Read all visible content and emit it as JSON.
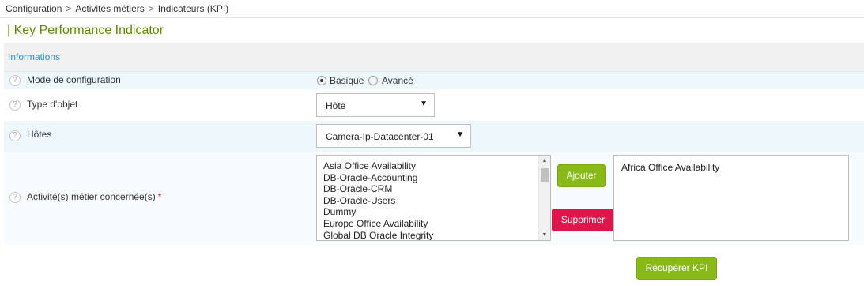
{
  "breadcrumb": {
    "items": [
      "Configuration",
      "Activités métiers",
      "Indicateurs (KPI)"
    ],
    "separator": ">"
  },
  "page_title": "| Key Performance Indicator",
  "section": {
    "title": "Informations"
  },
  "form": {
    "help_icon": "?",
    "mode": {
      "label": "Mode de configuration",
      "options": [
        "Basique",
        "Avancé"
      ],
      "selected": "Basique"
    },
    "object_type": {
      "label": "Type d'objet",
      "value": "Hôte"
    },
    "hosts": {
      "label": "Hôtes",
      "value": "Camera-Ip-Datacenter-01"
    },
    "activities": {
      "label": "Activité(s) métier concernée(s)",
      "required_marker": "*",
      "available": [
        "Asia Office Availability",
        "DB-Oracle-Accounting",
        "DB-Oracle-CRM",
        "DB-Oracle-Users",
        "Dummy",
        "Europe Office Availability",
        "Global DB Oracle Integrity"
      ],
      "selected": [
        "Africa Office Availability"
      ],
      "add_label": "Ajouter",
      "remove_label": "Supprimer"
    }
  },
  "actions": {
    "fetch_label": "Récupérer KPI"
  },
  "colors": {
    "title_green": "#5b8a00",
    "section_blue": "#2f8cc4",
    "button_green": "#88b917",
    "button_red": "#e0154b",
    "row_alt": "#eef8fc"
  },
  "icons": [
    "help-icon",
    "dropdown-arrow-icon",
    "scroll-up-icon",
    "scroll-down-icon"
  ]
}
